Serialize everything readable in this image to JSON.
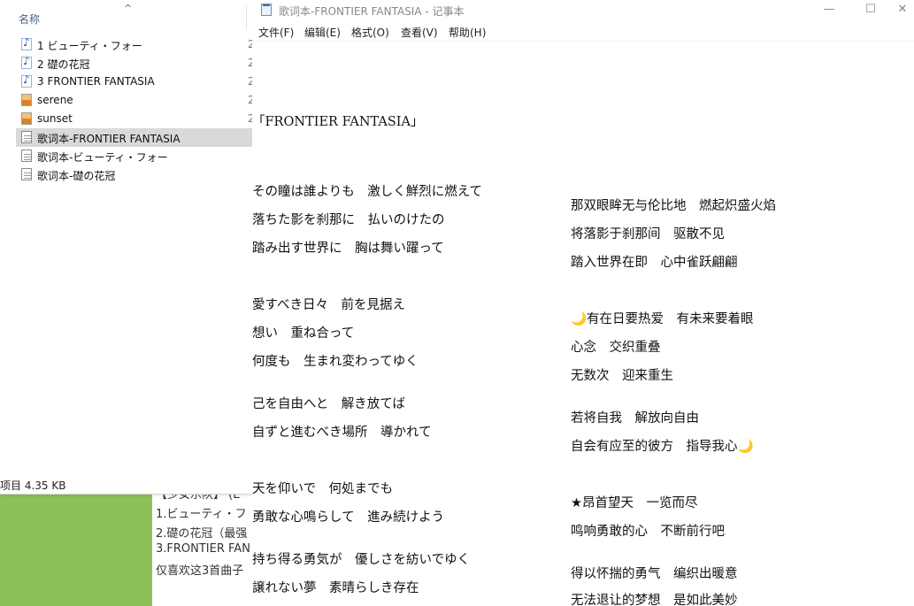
{
  "explorer": {
    "column_name": "名称",
    "files": [
      {
        "name": "1 ビューティ・フォー",
        "type": "music",
        "selected": false
      },
      {
        "name": "2 礎の花冠",
        "type": "music",
        "selected": false
      },
      {
        "name": "3 FRONTIER FANTASIA",
        "type": "music",
        "selected": false
      },
      {
        "name": "serene",
        "type": "image",
        "selected": false
      },
      {
        "name": "sunset",
        "type": "image",
        "selected": false
      },
      {
        "name": "歌词本-FRONTIER FANTASIA",
        "type": "text",
        "selected": true
      },
      {
        "name": "歌词本-ビューティ・フォー",
        "type": "text",
        "selected": false
      },
      {
        "name": "歌词本-礎の花冠",
        "type": "text",
        "selected": false
      }
    ],
    "clip_char": "2",
    "status": "项目  4.35 KB"
  },
  "background_note": {
    "lines": [
      "【少女乐队】 (E",
      "1.ビューティ・フ",
      "2.礎の花冠（最强",
      "3.FRONTIER FAN",
      "仅喜欢这3首曲子"
    ]
  },
  "notepad": {
    "title": "歌词本-FRONTIER FANTASIA - 记事本",
    "buttons": {
      "minimize": "—",
      "maximize": "☐",
      "close": "✕"
    },
    "menu": [
      "文件(F)",
      "编辑(E)",
      "格式(O)",
      "查看(V)",
      "帮助(H)"
    ],
    "song_title": "「FRONTIER FANTASIA」",
    "japanese": [
      "その瞳は誰よりも　激しく鮮烈に燃えて",
      "落ちた影を刹那に　払いのけたの",
      "踏み出す世界に　胸は舞い躍って",
      "愛すべき日々　前を見据え",
      "想い　重ね合って",
      "何度も　生まれ変わってゆく",
      "己を自由へと　解き放てば",
      "自ずと進むべき場所　導かれて",
      "天を仰いで　何処までも",
      "勇敢な心鳴らして　進み続けよう",
      "持ち得る勇気が　優しさを紡いでゆく",
      "譲れない夢　素晴らしき存在"
    ],
    "chinese": [
      "那双眼眸无与伦比地　燃起炽盛火焰",
      "将落影于刹那间　驱散不见",
      "踏入世界在即　心中雀跃翩翩",
      "🌙有在日要热爱　有未来要着眼",
      "心念　交织重叠",
      "无数次　迎来重生",
      "若将自我　解放向自由",
      "自会有应至的彼方　指导我心🌙",
      "★昂首望天　一览而尽",
      "鸣响勇敢的心　不断前行吧",
      "得以怀揣的勇气　编织出暖意",
      "无法退让的梦想　是如此美妙"
    ]
  }
}
